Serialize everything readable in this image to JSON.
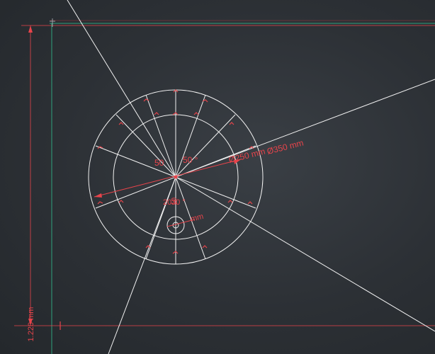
{
  "colors": {
    "background": "#2c3035",
    "geometry": "#f2f2f2",
    "dimension": "#e8444b",
    "axis_green": "#2fa37e"
  },
  "labels": {
    "vertical_dimension": "1.220 mm",
    "diameter_250": "Ø250 mm",
    "diameter_350": "Ø350 mm",
    "angle_left": "50",
    "angle_right": "50 °",
    "angle_lower": "20",
    "angle_lower_2": "30 °",
    "radius_small": "10",
    "small_circle_label": "mm"
  },
  "icons": {
    "axis_marker": "axis-origin-marker-icon",
    "arc_tick": "angle-arc-tick-icon"
  }
}
